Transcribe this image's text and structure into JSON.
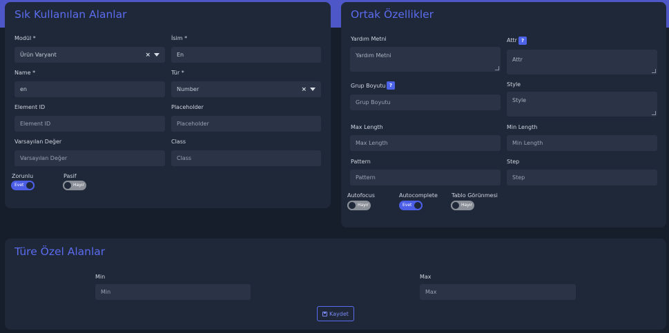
{
  "common_fields": {
    "title": "Sık Kullanılan Alanlar",
    "modul_label": "Modül *",
    "modul_value": "Ürün Varyant",
    "isim_label": "İsim *",
    "isim_value": "En",
    "name_label": "Name *",
    "name_value": "en",
    "tur_label": "Tür *",
    "tur_value": "Number",
    "element_id_label": "Element ID",
    "element_id_placeholder": "Element ID",
    "placeholder_label": "Placeholder",
    "placeholder_placeholder": "Placeholder",
    "default_label": "Varsayılan Değer",
    "default_placeholder": "Varsayılan Değer",
    "class_label": "Class",
    "class_placeholder": "Class",
    "required_label": "Zorunlu",
    "required_toggle": "Evet",
    "passive_label": "Pasif",
    "passive_toggle": "Hayır"
  },
  "common_props": {
    "title": "Ortak Özellikler",
    "help_text_label": "Yardım Metni",
    "help_text_placeholder": "Yardım Metni",
    "attr_label": "Attr",
    "attr_placeholder": "Attr",
    "group_size_label": "Grup Boyutu",
    "group_size_placeholder": "Grup Boyutu",
    "style_label": "Style",
    "style_placeholder": "Style",
    "help_badge": "?",
    "max_length_label": "Max Length",
    "max_length_placeholder": "Max Length",
    "min_length_label": "Min Length",
    "min_length_placeholder": "Min Length",
    "pattern_label": "Pattern",
    "pattern_placeholder": "Pattern",
    "step_label": "Step",
    "step_placeholder": "Step",
    "autofocus_label": "Autofocus",
    "autofocus_toggle": "Hayır",
    "autocomplete_label": "Autocomplete",
    "autocomplete_toggle": "Evet",
    "table_visible_label": "Tablo Görünmesi",
    "table_visible_toggle": "Hayır"
  },
  "type_specific": {
    "title": "Türe Özel Alanlar",
    "min_label": "Min",
    "min_placeholder": "Min",
    "max_label": "Max",
    "max_placeholder": "Max",
    "save_label": "Kaydet"
  },
  "colors": {
    "accent": "#5b6cf0",
    "card_bg": "#1f2838",
    "page_bg": "#161d2b",
    "input_bg": "#2a3446"
  }
}
